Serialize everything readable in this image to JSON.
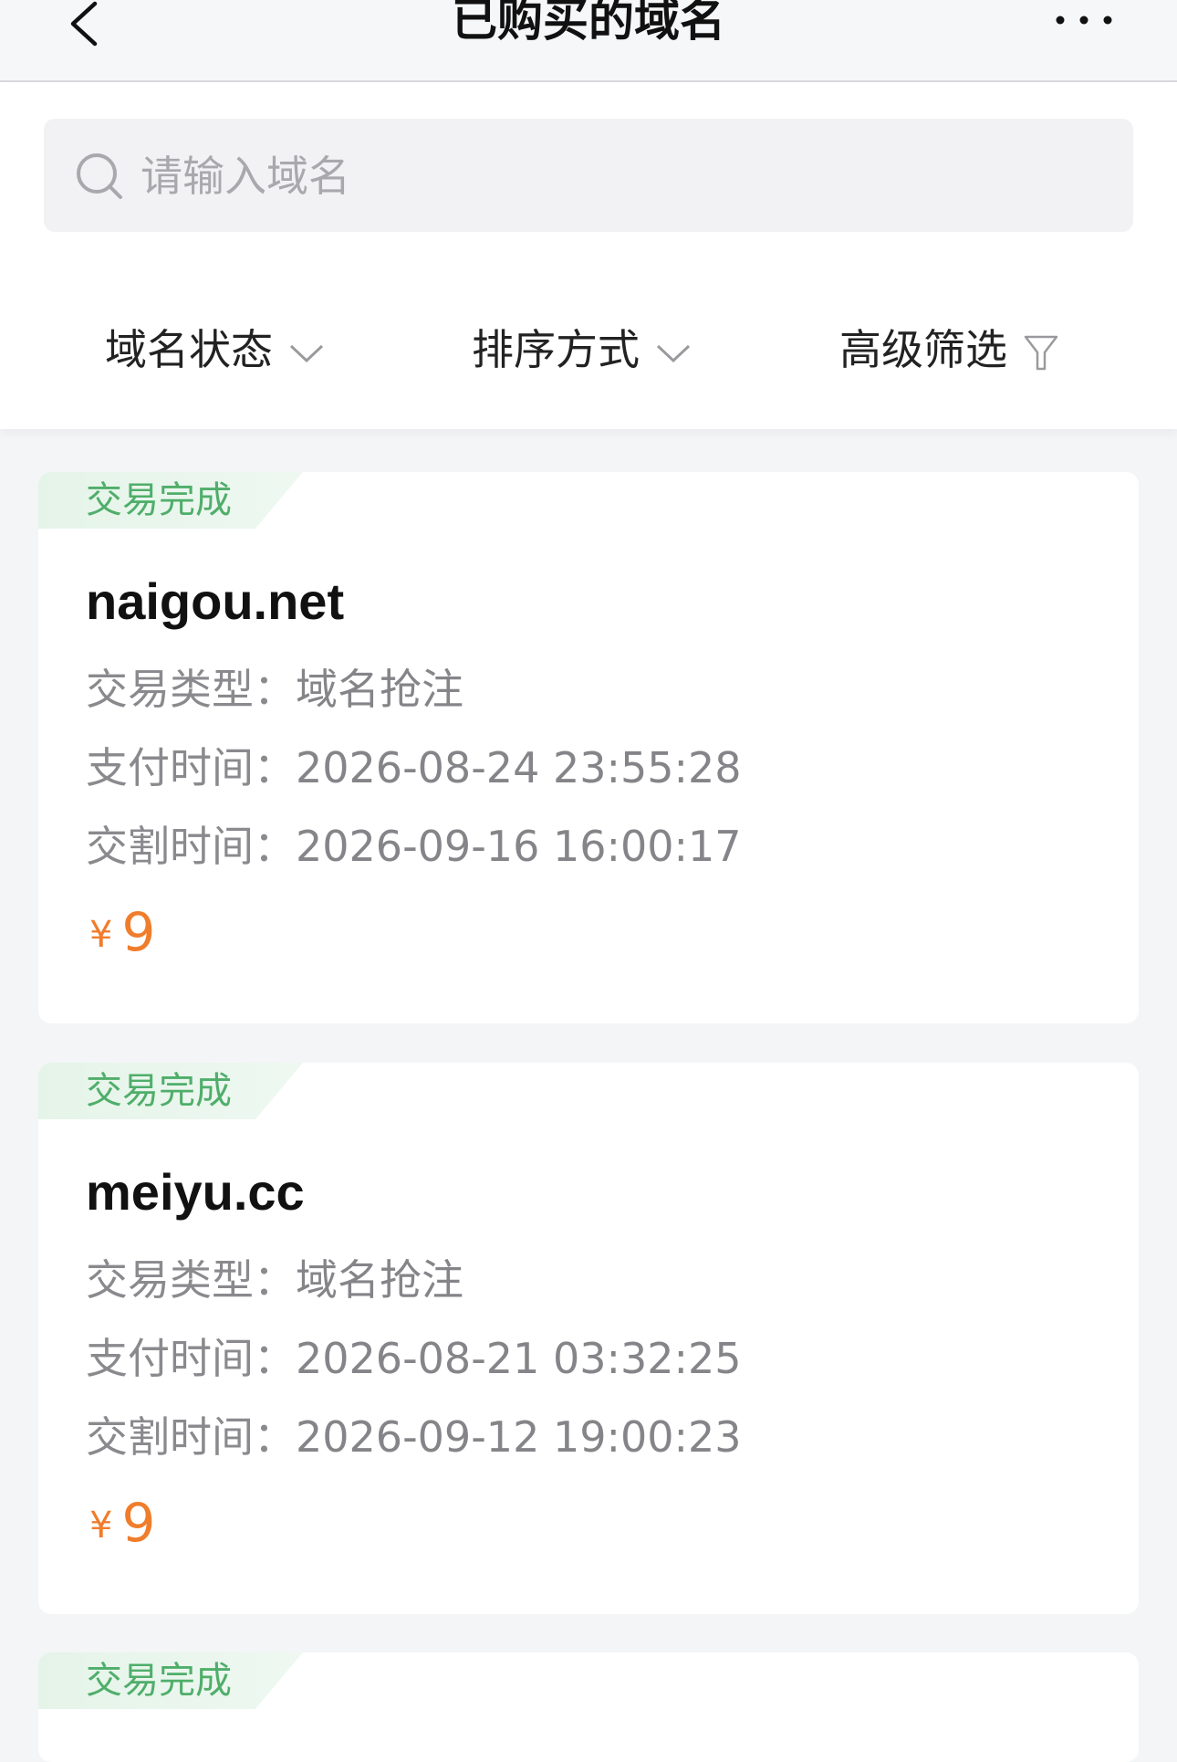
{
  "nav": {
    "title": "已购买的域名",
    "back_icon": "chevron-left-icon",
    "more_icon": "ellipsis-icon"
  },
  "search": {
    "placeholder": "请输入域名",
    "value": "",
    "icon": "search-icon"
  },
  "filters": [
    {
      "label": "域名状态",
      "icon": "chevron-down-icon"
    },
    {
      "label": "排序方式",
      "icon": "chevron-down-icon"
    },
    {
      "label": "高级筛选",
      "icon": "funnel-icon"
    }
  ],
  "colors": {
    "status_green": "#4fae6a",
    "price_orange": "#ef7d2c",
    "background": "#f4f5f7"
  },
  "orders": [
    {
      "status": "交易完成",
      "domain": "naigou.net",
      "type_label": "交易类型：",
      "type_value": "域名抢注",
      "pay_label": "支付时间：",
      "pay_value": "2026-08-24 23:55:28",
      "deliver_label": "交割时间：",
      "deliver_value": "2026-09-16 16:00:17",
      "currency": "¥",
      "price": "9"
    },
    {
      "status": "交易完成",
      "domain": "meiyu.cc",
      "type_label": "交易类型：",
      "type_value": "域名抢注",
      "pay_label": "支付时间：",
      "pay_value": "2026-08-21 03:32:25",
      "deliver_label": "交割时间：",
      "deliver_value": "2026-09-12 19:00:23",
      "currency": "¥",
      "price": "9"
    },
    {
      "status": "交易完成"
    }
  ]
}
